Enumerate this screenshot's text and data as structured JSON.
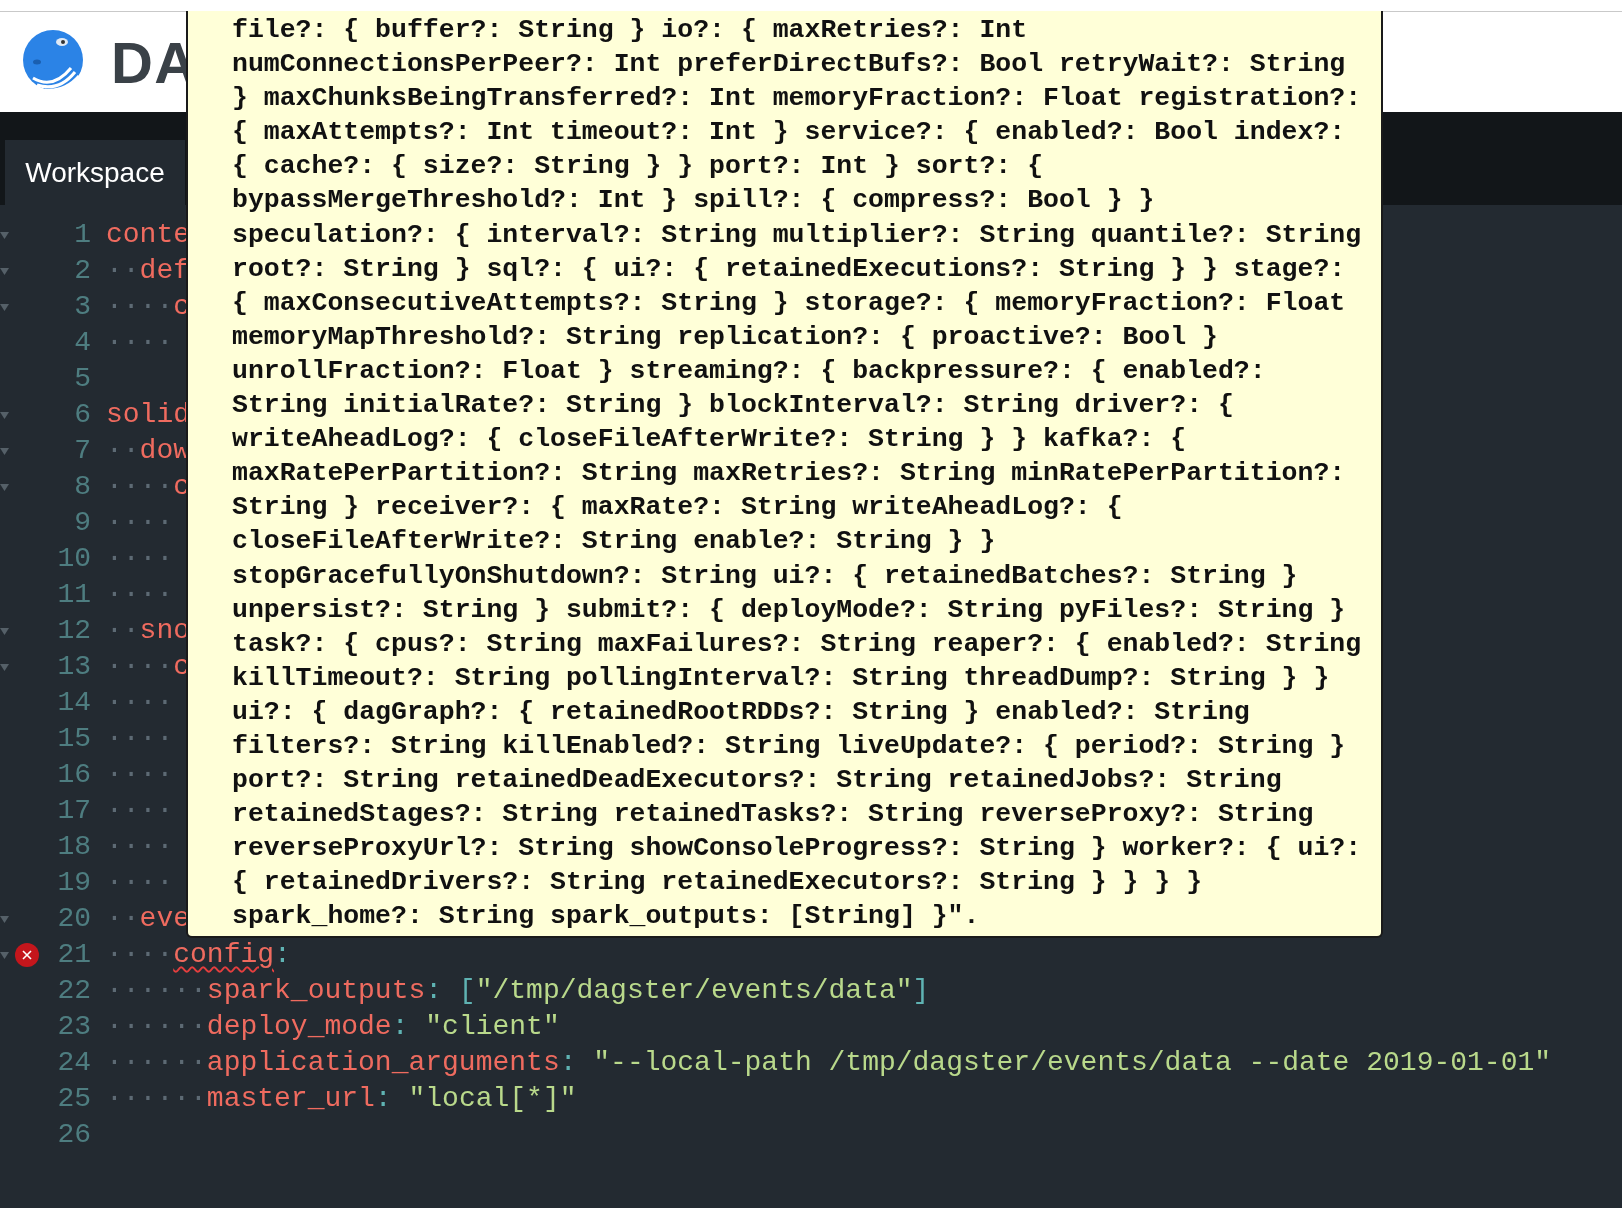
{
  "header": {
    "logo_text": "DA"
  },
  "nav": {
    "tabs": [
      {
        "label": "Workspace",
        "selected": true
      }
    ]
  },
  "editor": {
    "lines": [
      {
        "number": "1",
        "fold": true,
        "error": false,
        "tokens": [
          {
            "kind": "key",
            "text": "conte",
            "error_underline": false
          }
        ]
      },
      {
        "number": "2",
        "fold": true,
        "error": false,
        "indent": "··",
        "tokens": [
          {
            "kind": "key",
            "text": "def",
            "error_underline": false
          }
        ]
      },
      {
        "number": "3",
        "fold": true,
        "error": false,
        "indent": "····",
        "tokens": [
          {
            "kind": "key",
            "text": "c",
            "error_underline": false
          }
        ]
      },
      {
        "number": "4",
        "fold": false,
        "error": false,
        "indent": "····"
      },
      {
        "number": "5",
        "fold": false,
        "error": false
      },
      {
        "number": "6",
        "fold": true,
        "error": false,
        "tokens": [
          {
            "kind": "key",
            "text": "solid",
            "error_underline": false
          }
        ]
      },
      {
        "number": "7",
        "fold": true,
        "error": false,
        "indent": "··",
        "tokens": [
          {
            "kind": "key",
            "text": "dow",
            "error_underline": false
          }
        ]
      },
      {
        "number": "8",
        "fold": true,
        "error": false,
        "indent": "····",
        "tokens": [
          {
            "kind": "key",
            "text": "c",
            "error_underline": false
          }
        ]
      },
      {
        "number": "9",
        "fold": false,
        "error": false,
        "indent": "····"
      },
      {
        "number": "10",
        "fold": false,
        "error": false,
        "indent": "····"
      },
      {
        "number": "11",
        "fold": false,
        "error": false,
        "indent": "····"
      },
      {
        "number": "12",
        "fold": true,
        "error": false,
        "indent": "··",
        "tokens": [
          {
            "kind": "key",
            "text": "sno",
            "error_underline": false
          }
        ]
      },
      {
        "number": "13",
        "fold": true,
        "error": false,
        "indent": "····",
        "tokens": [
          {
            "kind": "key",
            "text": "c",
            "error_underline": false
          }
        ]
      },
      {
        "number": "14",
        "fold": false,
        "error": false,
        "indent": "····"
      },
      {
        "number": "15",
        "fold": false,
        "error": false,
        "indent": "····"
      },
      {
        "number": "16",
        "fold": false,
        "error": false,
        "indent": "····"
      },
      {
        "number": "17",
        "fold": false,
        "error": false,
        "indent": "····"
      },
      {
        "number": "18",
        "fold": false,
        "error": false,
        "indent": "····"
      },
      {
        "number": "19",
        "fold": false,
        "error": false,
        "indent": "····"
      },
      {
        "number": "20",
        "fold": true,
        "error": false,
        "indent": "··",
        "tokens": [
          {
            "kind": "key",
            "text": "eve",
            "error_underline": false
          }
        ]
      },
      {
        "number": "21",
        "fold": true,
        "error": true,
        "indent": "····",
        "tokens": [
          {
            "kind": "key",
            "text": "config",
            "error_underline": true
          },
          {
            "kind": "punct",
            "text": ":",
            "error_underline": false
          }
        ]
      },
      {
        "number": "22",
        "fold": false,
        "error": false,
        "indent": "······",
        "tokens": [
          {
            "kind": "key",
            "text": "spark_outputs",
            "error_underline": false
          },
          {
            "kind": "punct",
            "text": ": [",
            "error_underline": false
          },
          {
            "kind": "string",
            "text": "\"/tmp/dagster/events/data\"",
            "error_underline": false
          },
          {
            "kind": "punct",
            "text": "]",
            "error_underline": false
          }
        ]
      },
      {
        "number": "23",
        "fold": false,
        "error": false,
        "indent": "······",
        "tokens": [
          {
            "kind": "key",
            "text": "deploy_mode",
            "error_underline": false
          },
          {
            "kind": "punct",
            "text": ": ",
            "error_underline": false
          },
          {
            "kind": "string",
            "text": "\"client\"",
            "error_underline": false
          }
        ]
      },
      {
        "number": "24",
        "fold": false,
        "error": false,
        "indent": "······",
        "tokens": [
          {
            "kind": "key",
            "text": "application_arguments",
            "error_underline": false
          },
          {
            "kind": "punct",
            "text": ": ",
            "error_underline": false
          },
          {
            "kind": "string",
            "text": "\"--local-path /tmp/dagster/events/data --date 2019-01-01\"",
            "error_underline": false
          }
        ]
      },
      {
        "number": "25",
        "fold": false,
        "error": false,
        "indent": "······",
        "tokens": [
          {
            "kind": "key",
            "text": "master_url",
            "error_underline": false
          },
          {
            "kind": "punct",
            "text": ": ",
            "error_underline": false
          },
          {
            "kind": "string",
            "text": "\"local[*]\"",
            "error_underline": false
          }
        ]
      },
      {
        "number": "26",
        "fold": false,
        "error": false
      }
    ]
  },
  "tooltip": {
    "lines": [
      "file?: { buffer?: String } io?: { maxRetries?: Int",
      "numConnectionsPerPeer?: Int preferDirectBufs?: Bool retryWait?: String",
      "} maxChunksBeingTransferred?: Int memoryFraction?: Float registration?:",
      "{ maxAttempts?: Int timeout?: Int } service?: { enabled?: Bool index?:",
      "{ cache?: { size?: String } } port?: Int } sort?: {",
      "bypassMergeThreshold?: Int } spill?: { compress?: Bool } }",
      "speculation?: { interval?: String multiplier?: String quantile?: String",
      "root?: String } sql?: { ui?: { retainedExecutions?: String } } stage?:",
      "{ maxConsecutiveAttempts?: String } storage?: { memoryFraction?: Float",
      "memoryMapThreshold?: String replication?: { proactive?: Bool }",
      "unrollFraction?: Float } streaming?: { backpressure?: { enabled?:",
      "String initialRate?: String } blockInterval?: String driver?: {",
      "writeAheadLog?: { closeFileAfterWrite?: String } } kafka?: {",
      "maxRatePerPartition?: String maxRetries?: String minRatePerPartition?:",
      "String } receiver?: { maxRate?: String writeAheadLog?: {",
      "closeFileAfterWrite?: String enable?: String } }",
      "stopGracefullyOnShutdown?: String ui?: { retainedBatches?: String }",
      "unpersist?: String } submit?: { deployMode?: String pyFiles?: String }",
      "task?: { cpus?: String maxFailures?: String reaper?: { enabled?: String",
      "killTimeout?: String pollingInterval?: String threadDump?: String } }",
      "ui?: { dagGraph?: { retainedRootRDDs?: String } enabled?: String",
      "filters?: String killEnabled?: String liveUpdate?: { period?: String }",
      "port?: String retainedDeadExecutors?: String retainedJobs?: String",
      "retainedStages?: String retainedTasks?: String reverseProxy?: String",
      "reverseProxyUrl?: String showConsoleProgress?: String } worker?: { ui?:",
      "{ retainedDrivers?: String retainedExecutors?: String } } } }",
      "spark_home?: String spark_outputs: [String] }\"."
    ]
  }
}
